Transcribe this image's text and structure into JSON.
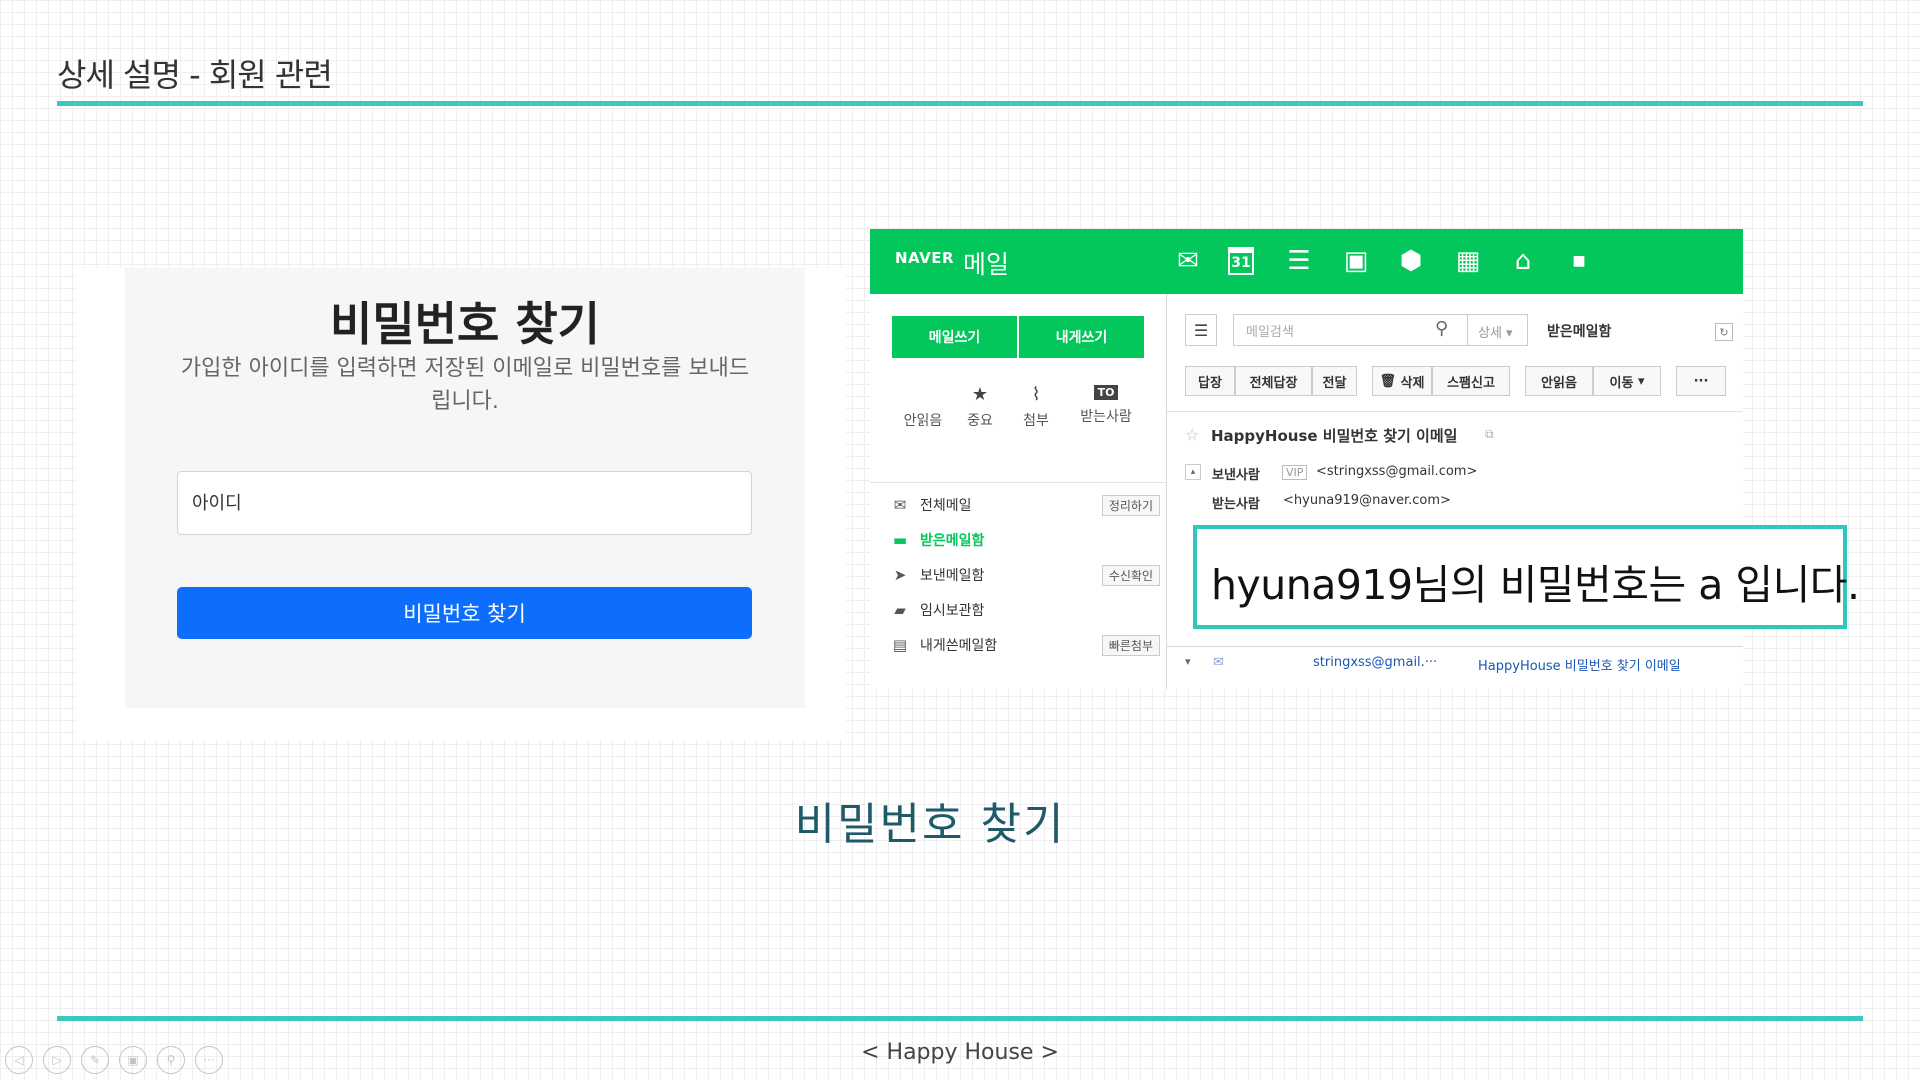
{
  "slide": {
    "title": "상세 설명 - 회원 관련",
    "caption": "비밀번호 찾기",
    "footer": "< Happy House >",
    "accent_color": "#3cc8c0",
    "controls": [
      "prev-icon",
      "next-icon",
      "pen-icon",
      "pages-icon",
      "zoom-icon",
      "more-icon"
    ]
  },
  "find_password": {
    "title": "비밀번호 찾기",
    "description": "가입한 아이디를 입력하면 저장된 이메일로 비밀번호를 보내드립니다.",
    "id_placeholder": "아이디",
    "submit_label": "비밀번호 찾기",
    "button_color": "#0d6efd"
  },
  "naver_mail": {
    "logo": "NAVER",
    "logo_suffix": "메일",
    "brand_color": "#03c75a",
    "top_icons": [
      "mail-icon",
      "calendar-icon",
      "list-icon",
      "contacts-icon",
      "cube-icon",
      "memo-icon",
      "home-icon",
      "small-square-icon"
    ],
    "calendar_day": "31",
    "write_button": "메일쓰기",
    "self_write_button": "내게쓰기",
    "quick_filters": [
      {
        "label": "안읽음",
        "icon": "unread-icon"
      },
      {
        "label": "중요",
        "icon": "star-icon"
      },
      {
        "label": "첨부",
        "icon": "paperclip-icon"
      },
      {
        "label": "받는사람",
        "icon": "to-icon",
        "glyph": "TO"
      }
    ],
    "folders": [
      {
        "label": "전체메일",
        "icon": "envelope-icon",
        "badge": "정리하기"
      },
      {
        "label": "받은메일함",
        "icon": "inbox-icon",
        "badge": ""
      },
      {
        "label": "보낸메일함",
        "icon": "send-icon",
        "badge": "수신확인"
      },
      {
        "label": "임시보관함",
        "icon": "folder-icon",
        "badge": ""
      },
      {
        "label": "내게쓴메일함",
        "icon": "note-icon",
        "badge": "빠른첨부"
      }
    ],
    "search_placeholder": "메일검색",
    "search_detail": "상세",
    "current_box": "받은메일함",
    "toolbar": [
      "답장",
      "전체답장",
      "전달",
      "삭제",
      "스팸신고",
      "안읽음",
      "이동",
      "···"
    ],
    "subject": "HappyHouse 비밀번호 찾기 이메일",
    "from_label": "보낸사람",
    "vip": "VIP",
    "from_address": "<stringxss@gmail.com>",
    "to_label": "받는사람",
    "to_address": "<hyuna919@naver.com>",
    "body": "hyuna919님의 비밀번호는 a 입니다.",
    "list_sender": "stringxss@gmail.···",
    "list_subject": "HappyHouse 비밀번호 찾기 이메일"
  }
}
